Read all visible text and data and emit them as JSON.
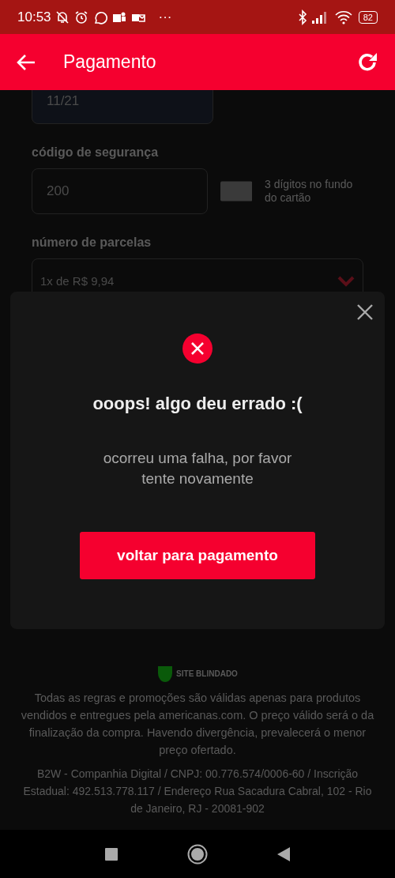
{
  "status_bar": {
    "time": "10:53",
    "more": "···",
    "battery": "82"
  },
  "app_bar": {
    "title": "Pagamento"
  },
  "form": {
    "expiry_value": "11/21",
    "cvv_label": "código de segurança",
    "cvv_value": "200",
    "cvv_hint": "3 dígitos no fundo do cartão",
    "installments_label": "número de parcelas",
    "installments_value": "1x de R$ 9,94"
  },
  "footer": {
    "badge": "SITE BLINDADO",
    "disclaimer": "Todas as regras e promoções são válidas apenas para produtos vendidos e entregues pela americanas.com. O preço válido será o da finalização da compra. Havendo divergência, prevalecerá o menor preço ofertado.",
    "company": "B2W - Companhia Digital / CNPJ: 00.776.574/0006-60 / Inscrição Estadual: 492.513.778.117 / Endereço Rua Sacadura Cabral, 102 - Rio de Janeiro, RJ - 20081-902"
  },
  "dialog": {
    "title": "ooops! algo deu errado :(",
    "message": "ocorreu uma falha, por favor tente novamente",
    "button": "voltar para pagamento"
  }
}
